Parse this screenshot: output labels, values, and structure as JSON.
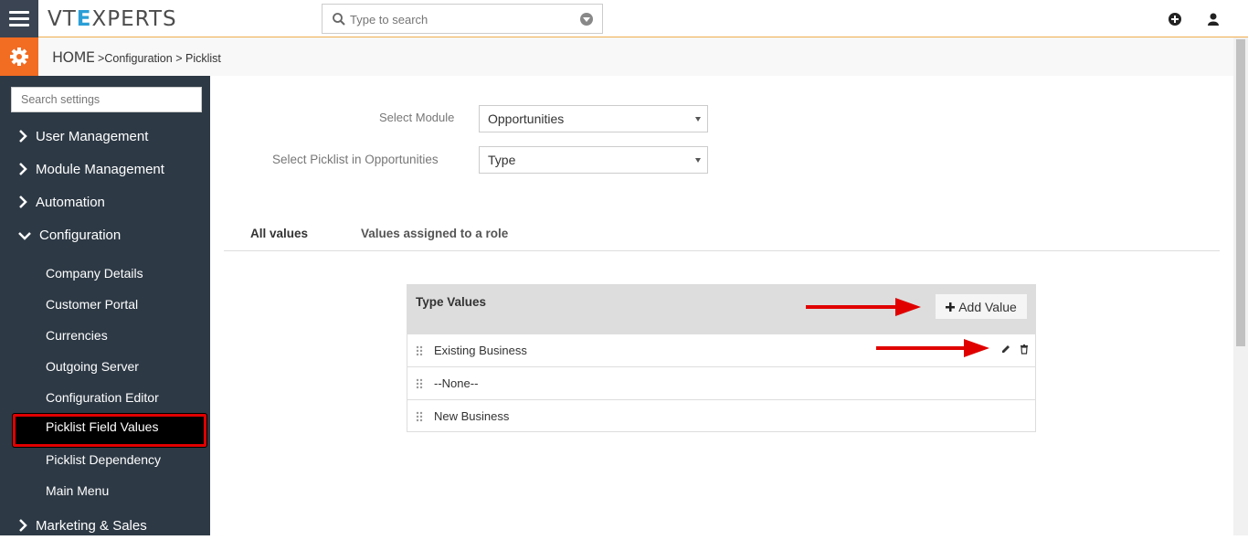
{
  "header": {
    "logo_prefix": "VT",
    "logo_x": "E",
    "logo_suffix": "XPERTS",
    "search_placeholder": "Type to search"
  },
  "breadcrumb": {
    "home": "HOME",
    "sep1": ">",
    "item1": "Configuration",
    "sep2": ">",
    "item2": "Picklist"
  },
  "sidebar": {
    "search_placeholder": "Search settings",
    "sections": [
      {
        "label": "User Management"
      },
      {
        "label": "Module Management"
      },
      {
        "label": "Automation"
      },
      {
        "label": "Configuration"
      }
    ],
    "config_items": [
      {
        "label": "Company Details"
      },
      {
        "label": "Customer Portal"
      },
      {
        "label": "Currencies"
      },
      {
        "label": "Outgoing Server"
      },
      {
        "label": "Configuration Editor"
      },
      {
        "label": "Picklist Field Values"
      },
      {
        "label": "Picklist Dependency"
      },
      {
        "label": "Main Menu"
      }
    ],
    "last_section": {
      "label": "Marketing & Sales"
    }
  },
  "form": {
    "module_label": "Select Module",
    "module_value": "Opportunities",
    "picklist_label": "Select Picklist in Opportunities",
    "picklist_value": "Type"
  },
  "tabs": [
    {
      "label": "All values"
    },
    {
      "label": "Values assigned to a role"
    }
  ],
  "panel": {
    "title": "Type Values",
    "add_button": "Add Value",
    "rows": [
      {
        "label": "Existing Business"
      },
      {
        "label": "--None--"
      },
      {
        "label": "New Business"
      }
    ]
  },
  "colors": {
    "accent": "#f26c22",
    "sidebar_bg": "#2d3945",
    "highlight_border": "#e00000",
    "arrow": "#e00000"
  }
}
